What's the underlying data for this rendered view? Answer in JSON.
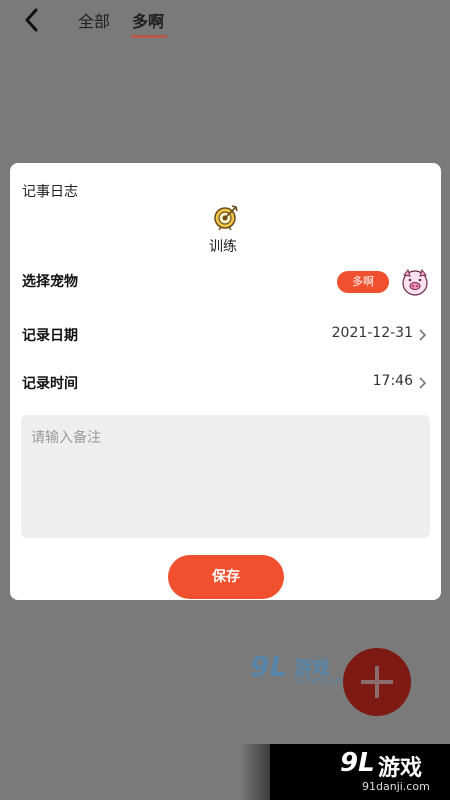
{
  "header": {
    "tabs": [
      {
        "label": "全部",
        "active": false
      },
      {
        "label": "多啊",
        "active": true
      }
    ]
  },
  "dialog": {
    "title": "记事日志",
    "category": {
      "icon": "target-icon",
      "label": "训练"
    },
    "pet": {
      "label": "选择宠物",
      "selected": "多啊",
      "avatar": "pig-avatar-icon"
    },
    "date": {
      "label": "记录日期",
      "value": "2021-12-31"
    },
    "time": {
      "label": "记录时间",
      "value": "17:46"
    },
    "note": {
      "placeholder": "请输入备注",
      "value": ""
    },
    "save_label": "保存"
  },
  "watermark": {
    "logo_mark": "9L",
    "name": "游戏",
    "url": "91danji.com"
  },
  "colors": {
    "accent": "#f0502d",
    "overlay": "#7a7a7a",
    "fab": "#7d1a13"
  }
}
